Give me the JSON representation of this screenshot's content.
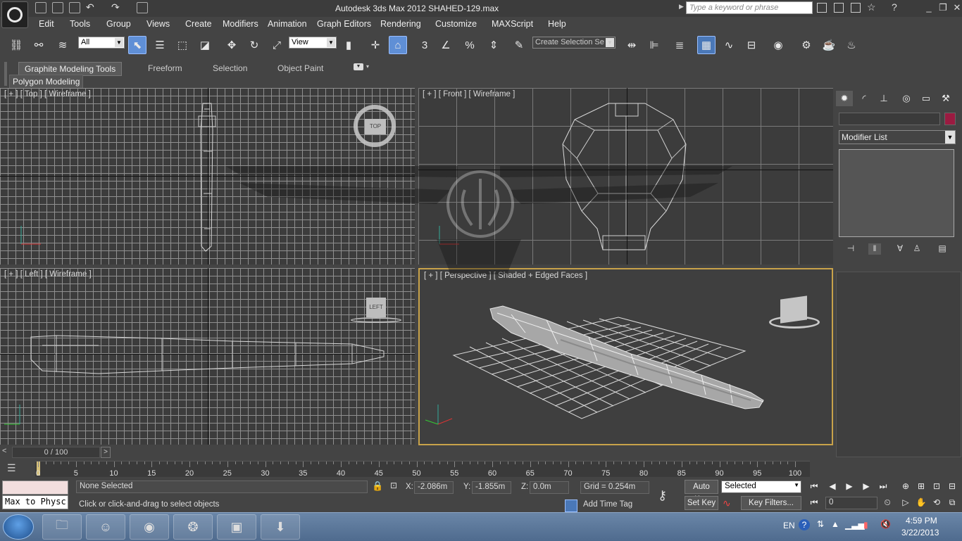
{
  "titlebar": {
    "title": "Autodesk 3ds Max  2012     SHAHED-129.max",
    "search_placeholder": "Type a keyword or phrase"
  },
  "menu": [
    "Edit",
    "Tools",
    "Group",
    "Views",
    "Create",
    "Modifiers",
    "Animation",
    "Graph Editors",
    "Rendering",
    "Customize",
    "MAXScript",
    "Help"
  ],
  "toolbar": {
    "selection_filter": "All",
    "ref_coord": "View",
    "snap_label": "3",
    "named_selection": "Create Selection Se"
  },
  "ribbon": {
    "tabs": [
      "Graphite Modeling Tools",
      "Freeform",
      "Selection",
      "Object Paint"
    ],
    "active_tab": "Graphite Modeling Tools",
    "panel": "Polygon Modeling"
  },
  "viewports": {
    "top": {
      "label": "[ + ] [ Top ] [ Wireframe ]",
      "cube": "TOP"
    },
    "front": {
      "label": "[ + ] [ Front ] [ Wireframe ]"
    },
    "left": {
      "label": "[ + ] [ Left ] [ Wireframe ]",
      "cube": "LEFT"
    },
    "perspective": {
      "label": "[ + ] [ Perspective ] [ Shaded + Edged Faces ]"
    }
  },
  "command_panel": {
    "modifier_list": "Modifier List"
  },
  "timeline": {
    "slider": "0 / 100",
    "ticks": [
      "0",
      "5",
      "10",
      "15",
      "20",
      "25",
      "30",
      "35",
      "40",
      "45",
      "50",
      "55",
      "60",
      "65",
      "70",
      "75",
      "80",
      "85",
      "90",
      "95",
      "100"
    ]
  },
  "status": {
    "max_physc": "Max to Physc:",
    "selection": "None Selected",
    "prompt": "Click or click-and-drag to select objects",
    "x_label": "X:",
    "x_value": "-2.086m",
    "y_label": "Y:",
    "y_value": "-1.855m",
    "z_label": "Z:",
    "z_value": "0.0m",
    "grid": "Grid = 0.254m",
    "add_time_tag": "Add Time Tag",
    "auto_key": "Auto Key",
    "key_mode": "Selected",
    "set_key": "Set Key",
    "key_filters": "Key Filters...",
    "frame": "0"
  },
  "taskbar": {
    "lang": "EN",
    "time": "4:59 PM",
    "date": "3/22/2013"
  }
}
